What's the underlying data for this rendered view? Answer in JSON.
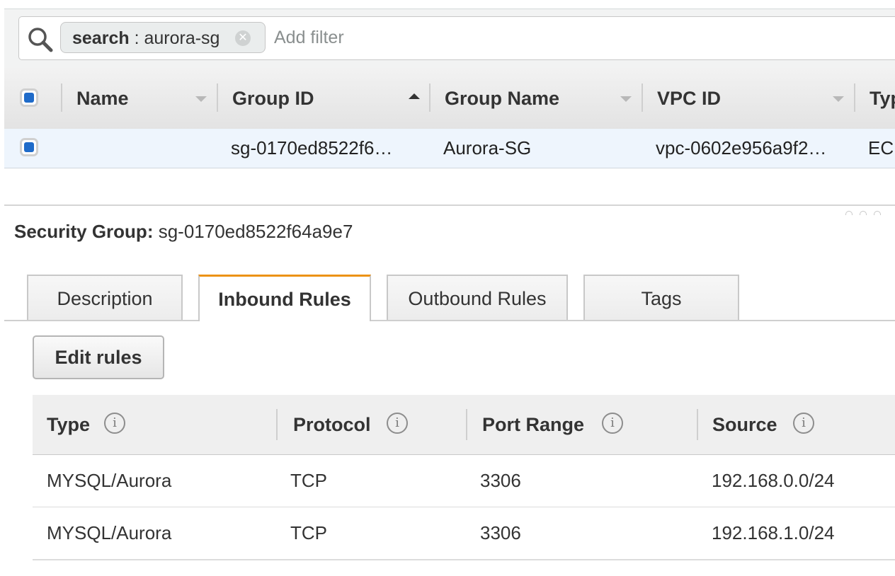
{
  "filter": {
    "token_key": "search",
    "token_value": "aurora-sg",
    "token_separator": " : ",
    "placeholder": "Add filter"
  },
  "grid": {
    "columns": [
      "Name",
      "Group ID",
      "Group Name",
      "VPC ID",
      "Typ"
    ],
    "rows": [
      {
        "name": "",
        "group_id": "sg-0170ed8522f6…",
        "group_name": "Aurora-SG",
        "vpc_id": "vpc-0602e956a9f2…",
        "type": "EC"
      }
    ]
  },
  "details": {
    "label": "Security Group:",
    "group_id": "sg-0170ed8522f64a9e7",
    "tabs": [
      "Description",
      "Inbound Rules",
      "Outbound Rules",
      "Tags"
    ],
    "active_tab": "Inbound Rules",
    "edit_button": "Edit rules",
    "rules_columns": [
      "Type",
      "Protocol",
      "Port Range",
      "Source"
    ],
    "rules": [
      {
        "type": "MYSQL/Aurora",
        "protocol": "TCP",
        "port_range": "3306",
        "source": "192.168.0.0/24"
      },
      {
        "type": "MYSQL/Aurora",
        "protocol": "TCP",
        "port_range": "3306",
        "source": "192.168.1.0/24"
      }
    ]
  },
  "colors": {
    "accent_tab": "#ec9215",
    "checkbox_fill": "#1f6bc9",
    "selected_row": "#eef5fd"
  },
  "icons": [
    "search-icon",
    "close-icon",
    "sort-icon",
    "info-icon",
    "resize-grip-icon"
  ]
}
